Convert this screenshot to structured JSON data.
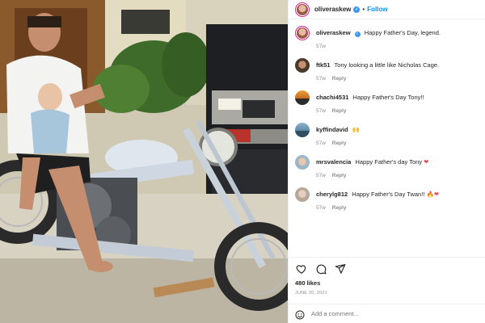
{
  "header": {
    "username": "oliveraskew",
    "separator": "•",
    "follow_label": "Follow"
  },
  "caption": {
    "username": "oliveraskew",
    "text": "Happy Father's Day, legend.",
    "age": "57w"
  },
  "comments": [
    {
      "username": "ftk51",
      "text": "Tony looking a little like Nicholas Cage.",
      "age": "57w",
      "reply_label": "Reply",
      "emoji": ""
    },
    {
      "username": "chachi4531",
      "text": "Happy Father's Day Tony!!",
      "age": "57w",
      "reply_label": "Reply",
      "emoji": ""
    },
    {
      "username": "kyffindavid",
      "text": "",
      "age": "57w",
      "reply_label": "Reply",
      "emoji": "🙌"
    },
    {
      "username": "mrsvalencia",
      "text": "Happy Father's day Tony",
      "age": "57w",
      "reply_label": "Reply",
      "emoji": "❤"
    },
    {
      "username": "cherylg812",
      "text": "Happy Father's Day Twan!!",
      "age": "57w",
      "reply_label": "Reply",
      "emoji": "🔥❤"
    }
  ],
  "likes": "480 likes",
  "date": "JUNE 20, 2021",
  "add_comment_placeholder": "Add a comment...",
  "icons": {
    "like": "heart-icon",
    "comment": "comment-bubble-icon",
    "share": "paper-plane-icon",
    "emoji": "smiley-icon",
    "verified": "verified-badge-icon"
  },
  "colors": {
    "follow": "#0095f6",
    "verified": "#3897f0",
    "heart": "#ed4956",
    "meta": "#8e8e8e"
  }
}
